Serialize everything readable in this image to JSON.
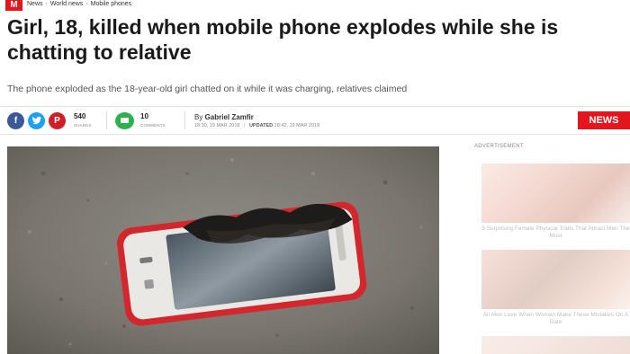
{
  "site": {
    "logo_letter": "M"
  },
  "breadcrumb": [
    "News",
    "World news",
    "Mobile phones"
  ],
  "article": {
    "headline": "Girl, 18, killed when mobile phone explodes while she is chatting to relative",
    "subheading": "The phone exploded as the 18-year-old girl chatted on it while it was charging, relatives claimed",
    "shares_count": "540",
    "shares_label": "SHARES",
    "comments_count": "10",
    "comments_label": "COMMENTS",
    "byline_prefix": "By",
    "author": "Gabriel Zamfir",
    "published": "18:30, 19 MAR 2018",
    "updated_label": "UPDATED",
    "updated": "18:42, 19 MAR 2018",
    "category_button": "NEWS"
  },
  "sidebar": {
    "ad_label": "ADVERTISEMENT",
    "ads": [
      {
        "caption": "5 Surprising Female Physical Traits That Attract Men The Most"
      },
      {
        "caption": "All Men Love When Women Make These Mistakes On A Date"
      }
    ]
  },
  "colors": {
    "brand_red": "#e3161d",
    "facebook": "#3b5998",
    "twitter": "#1da1f2",
    "pinterest": "#cb2027",
    "comments": "#2bb24c"
  },
  "icons": [
    "facebook-icon",
    "twitter-icon",
    "pinterest-icon",
    "comment-icon"
  ]
}
